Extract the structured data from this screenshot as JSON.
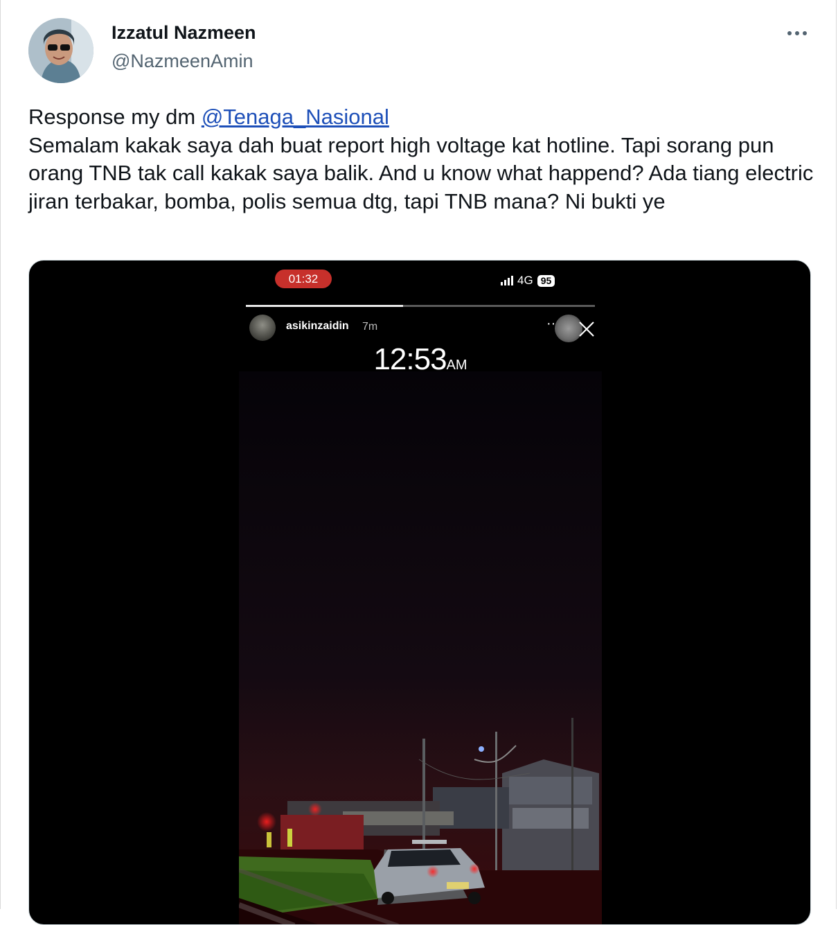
{
  "tweet": {
    "author_name": "Izzatul Nazmeen",
    "author_handle": "@NazmeenAmin",
    "more_icon": "more-horizontal-icon",
    "text_prefix": "Response my dm ",
    "mention": "@Tenaga_Nasional",
    "text_body": "Semalam kakak saya dah buat report high voltage kat hotline. Tapi sorang pun orang TNB tak call kakak saya balik. And u know what happend? Ada tiang electric jiran terbakar, bomba, polis semua dtg, tapi TNB mana? Ni bukti ye",
    "mention_color": "#1d4fb8"
  },
  "media": {
    "status_bar": {
      "recording_time": "01:32",
      "network": "4G",
      "battery": "95"
    },
    "story": {
      "username": "asikinzaidin",
      "time_ago": "7m",
      "progress_fraction": 0.45,
      "more_icon": "ellipsis-icon",
      "close_icon": "close-icon"
    },
    "sticker_time": "12:53",
    "sticker_ampm": "AM"
  }
}
